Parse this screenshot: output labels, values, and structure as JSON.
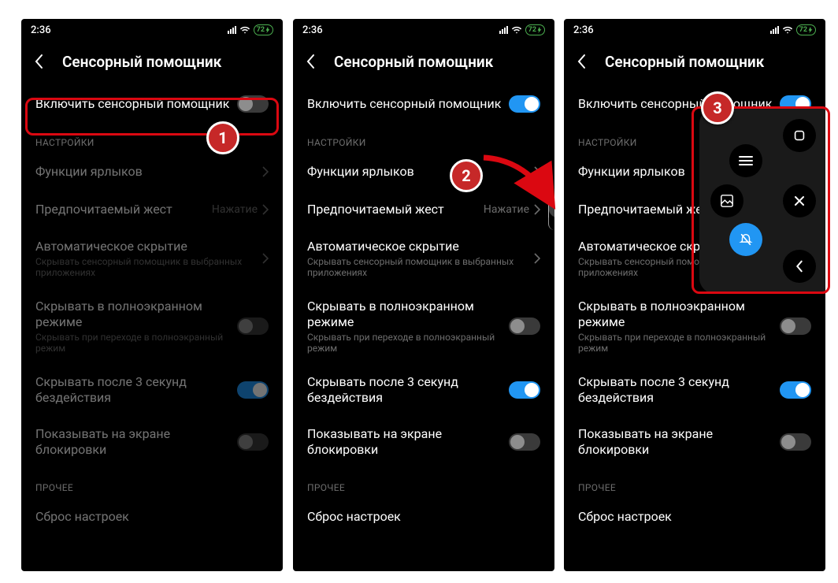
{
  "status": {
    "time": "2:36",
    "battery": "72"
  },
  "screenTitle": "Сенсорный помощник",
  "enableRow": {
    "label": "Включить сенсорный помощник"
  },
  "sections": {
    "settings": "НАСТРОЙКИ",
    "other": "ПРОЧЕЕ"
  },
  "rows": {
    "shortcuts": {
      "title": "Функции ярлыков"
    },
    "gesture": {
      "title": "Предпочитаемый жест",
      "value": "Нажатие"
    },
    "autohide": {
      "title": "Автоматическое скрытие",
      "sub": "Скрывать сенсорный помощник в выбранных приложениях"
    },
    "fullscreen": {
      "title": "Скрывать в полноэкранном режиме",
      "sub": "Скрывать при переходе в полноэкранный режим"
    },
    "idle": {
      "title": "Скрывать после 3 секунд бездействия"
    },
    "lockscreen": {
      "title": "Показывать на экране блокировки"
    },
    "reset": {
      "title": "Сброс настроек"
    }
  },
  "phones": {
    "p1": {
      "enableOn": false,
      "dimSettings": true
    },
    "p2": {
      "enableOn": true,
      "dimSettings": false
    },
    "p3": {
      "enableOn": true,
      "dimSettings": false,
      "showPanel": true
    }
  },
  "badges": {
    "b1": "1",
    "b2": "2",
    "b3": "3"
  },
  "atPanel": {
    "icons": [
      "home-icon",
      "menu-icon",
      "screenshot-icon",
      "close-icon",
      "mute-icon",
      "back-icon"
    ]
  }
}
